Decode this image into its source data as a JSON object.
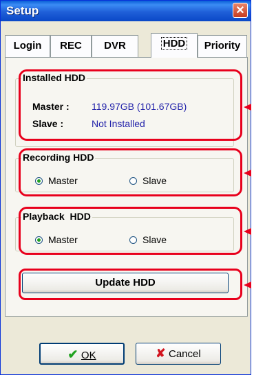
{
  "window": {
    "title": "Setup",
    "close_glyph": "✕"
  },
  "tabs": [
    "Login",
    "REC",
    "DVR",
    "HDD",
    "Priority"
  ],
  "active_tab": "HDD",
  "installed": {
    "title": "Installed HDD",
    "master_label": "Master :",
    "master_value": "119.97GB (101.67GB)",
    "slave_label": "Slave :",
    "slave_value": "Not Installed"
  },
  "recording": {
    "title": "Recording HDD",
    "option_master": "Master",
    "option_slave": "Slave",
    "selected": "Master"
  },
  "playback": {
    "title": "Playback  HDD",
    "option_master": "Master",
    "option_slave": "Slave",
    "selected": "Master"
  },
  "update_button": "Update HDD",
  "ok": {
    "icon": "check-icon",
    "label": "OK",
    "mnemonic": "O"
  },
  "cancel": {
    "icon": "x-icon",
    "label": "Cancel",
    "mnemonic": "C"
  },
  "colors": {
    "highlight": "#e8001c",
    "value_text": "#2222aa",
    "title_bar": "#0a5fd6"
  }
}
